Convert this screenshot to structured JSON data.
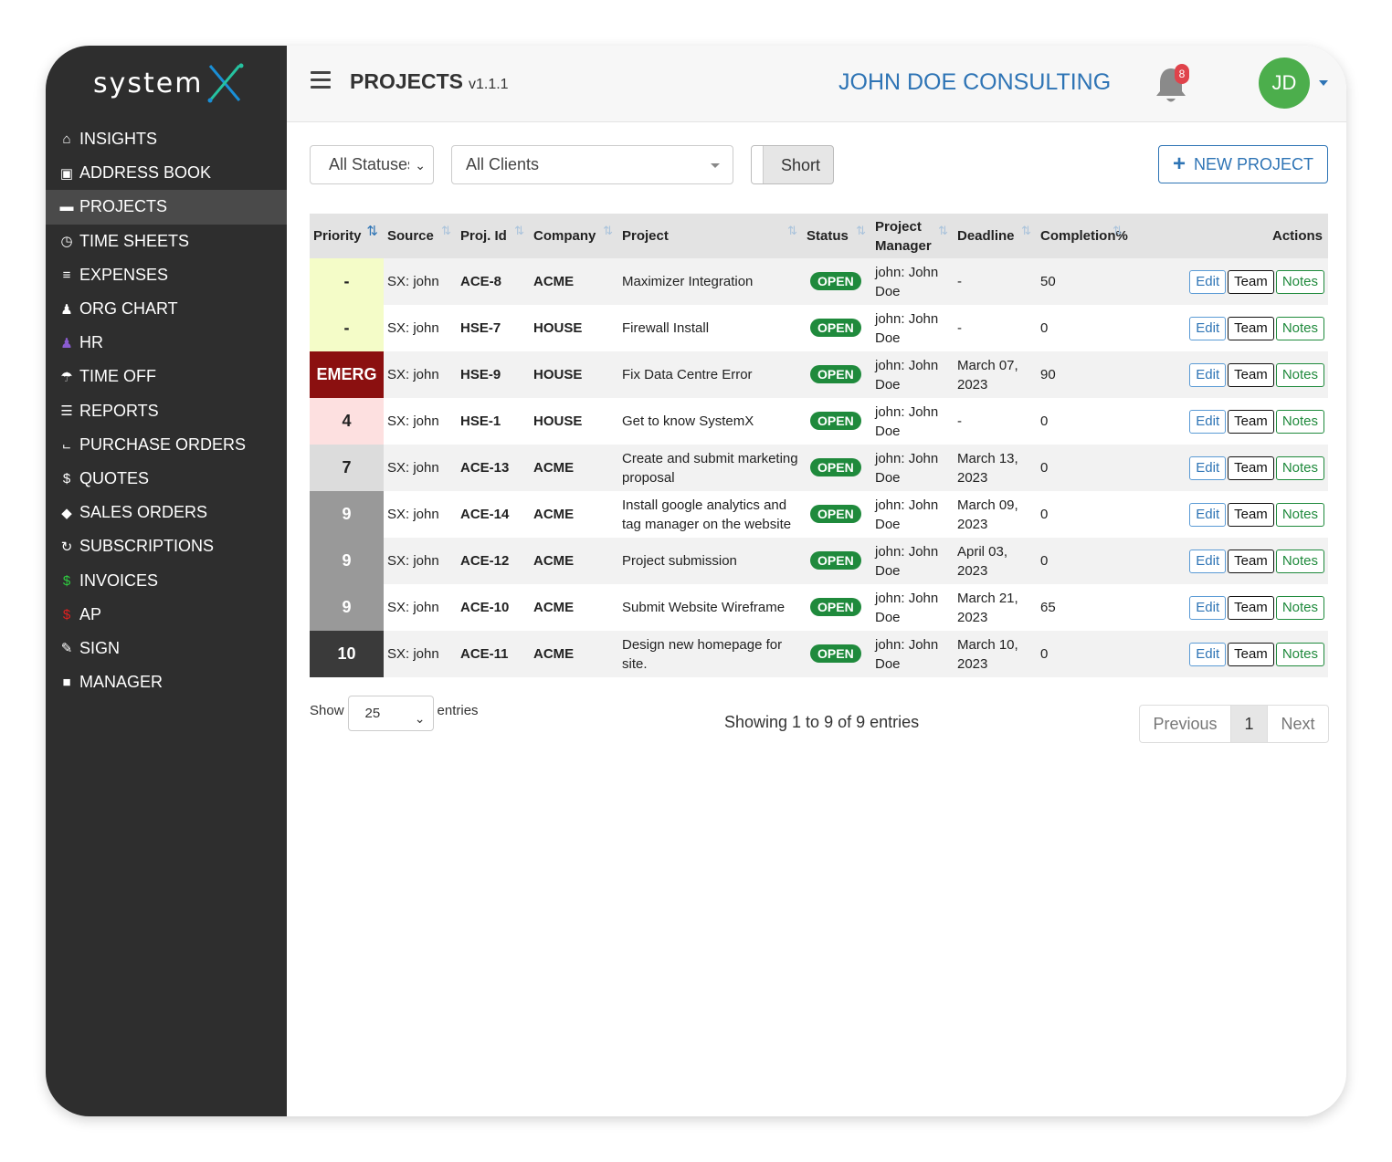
{
  "app": {
    "logo_text": "system",
    "logo_mark": "X",
    "accent": "#2e74b5",
    "sidebar_bg": "#2e2e2e"
  },
  "sidebar": {
    "items": [
      {
        "label": "INSIGHTS",
        "icon": "home-icon"
      },
      {
        "label": "ADDRESS BOOK",
        "icon": "address-book-icon"
      },
      {
        "label": "PROJECTS",
        "icon": "briefcase-icon",
        "active": true
      },
      {
        "label": "TIME SHEETS",
        "icon": "clock-icon"
      },
      {
        "label": "EXPENSES",
        "icon": "money-icon"
      },
      {
        "label": "ORG CHART",
        "icon": "user-icon"
      },
      {
        "label": "HR",
        "icon": "user-purple-icon"
      },
      {
        "label": "TIME OFF",
        "icon": "umbrella-beach-icon"
      },
      {
        "label": "REPORTS",
        "icon": "stack-icon"
      },
      {
        "label": "PURCHASE ORDERS",
        "icon": "cart-icon"
      },
      {
        "label": "QUOTES",
        "icon": "dollar-icon"
      },
      {
        "label": "SALES ORDERS",
        "icon": "tag-icon"
      },
      {
        "label": "SUBSCRIPTIONS",
        "icon": "refresh-icon"
      },
      {
        "label": "INVOICES",
        "icon": "dollar-green-icon"
      },
      {
        "label": "AP",
        "icon": "dollar-red-icon"
      },
      {
        "label": "SIGN",
        "icon": "pen-icon"
      },
      {
        "label": "MANAGER",
        "icon": "lock-icon"
      }
    ]
  },
  "header": {
    "title": "PROJECTS",
    "version": "v1.1.1",
    "company": "JOHN DOE CONSULTING",
    "notifications": "8",
    "avatar_initials": "JD"
  },
  "filters": {
    "status": "All Statuses",
    "clients": "All Clients",
    "toggle_label": "Short",
    "new_project_label": "NEW PROJECT"
  },
  "table": {
    "columns": [
      "Priority",
      "Source",
      "Proj. Id",
      "Company",
      "Project",
      "Status",
      "Project Manager",
      "Deadline",
      "Completion%",
      "Actions"
    ],
    "rows": [
      {
        "priority": "-",
        "prio_bg": "#f4fcc8",
        "prio_color": "#222",
        "source": "SX: john",
        "proj_id": "ACE-8",
        "company": "ACME",
        "project": "Maximizer Integration",
        "status": "OPEN",
        "manager": "john: John Doe",
        "deadline": "-",
        "overdue": false,
        "completion": "50"
      },
      {
        "priority": "-",
        "prio_bg": "#f4fcc8",
        "prio_color": "#222",
        "source": "SX: john",
        "proj_id": "HSE-7",
        "company": "HOUSE",
        "project": "Firewall Install",
        "status": "OPEN",
        "manager": "john: John Doe",
        "deadline": "-",
        "overdue": false,
        "completion": "0"
      },
      {
        "priority": "EMERG",
        "prio_bg": "#8b1010",
        "prio_color": "#ffffff",
        "source": "SX: john",
        "proj_id": "HSE-9",
        "company": "HOUSE",
        "project": "Fix Data Centre Error",
        "status": "OPEN",
        "manager": "john: John Doe",
        "deadline": "March 07, 2023",
        "overdue": true,
        "completion": "90"
      },
      {
        "priority": "4",
        "prio_bg": "#fde0e0",
        "prio_color": "#222",
        "source": "SX: john",
        "proj_id": "HSE-1",
        "company": "HOUSE",
        "project": "Get to know SystemX",
        "status": "OPEN",
        "manager": "john: John Doe",
        "deadline": "-",
        "overdue": false,
        "completion": "0"
      },
      {
        "priority": "7",
        "prio_bg": "#dcdcdc",
        "prio_color": "#222",
        "source": "SX: john",
        "proj_id": "ACE-13",
        "company": "ACME",
        "project": "Create and submit marketing proposal",
        "status": "OPEN",
        "manager": "john: John Doe",
        "deadline": "March 13, 2023",
        "overdue": true,
        "completion": "0"
      },
      {
        "priority": "9",
        "prio_bg": "#999999",
        "prio_color": "#ffffff",
        "source": "SX: john",
        "proj_id": "ACE-14",
        "company": "ACME",
        "project": "Install google analytics and tag manager on the website",
        "status": "OPEN",
        "manager": "john: John Doe",
        "deadline": "March 09, 2023",
        "overdue": true,
        "completion": "0"
      },
      {
        "priority": "9",
        "prio_bg": "#999999",
        "prio_color": "#ffffff",
        "source": "SX: john",
        "proj_id": "ACE-12",
        "company": "ACME",
        "project": "Project submission",
        "status": "OPEN",
        "manager": "john: John Doe",
        "deadline": "April 03, 2023",
        "overdue": false,
        "completion": "0"
      },
      {
        "priority": "9",
        "prio_bg": "#999999",
        "prio_color": "#ffffff",
        "source": "SX: john",
        "proj_id": "ACE-10",
        "company": "ACME",
        "project": "Submit Website Wireframe",
        "status": "OPEN",
        "manager": "john: John Doe",
        "deadline": "March 21, 2023",
        "overdue": true,
        "completion": "65"
      },
      {
        "priority": "10",
        "prio_bg": "#3a3a3a",
        "prio_color": "#ffffff",
        "source": "SX: john",
        "proj_id": "ACE-11",
        "company": "ACME",
        "project": "Design new homepage for site.",
        "status": "OPEN",
        "manager": "john: John Doe",
        "deadline": "March 10, 2023",
        "overdue": true,
        "completion": "0"
      }
    ],
    "actions": {
      "edit": "Edit",
      "team": "Team",
      "notes": "Notes"
    }
  },
  "footer": {
    "show_label": "Show",
    "entries_value": "25",
    "entries_label": "entries",
    "showing_text": "Showing 1 to 9 of 9 entries",
    "prev_label": "Previous",
    "page": "1",
    "next_label": "Next"
  }
}
